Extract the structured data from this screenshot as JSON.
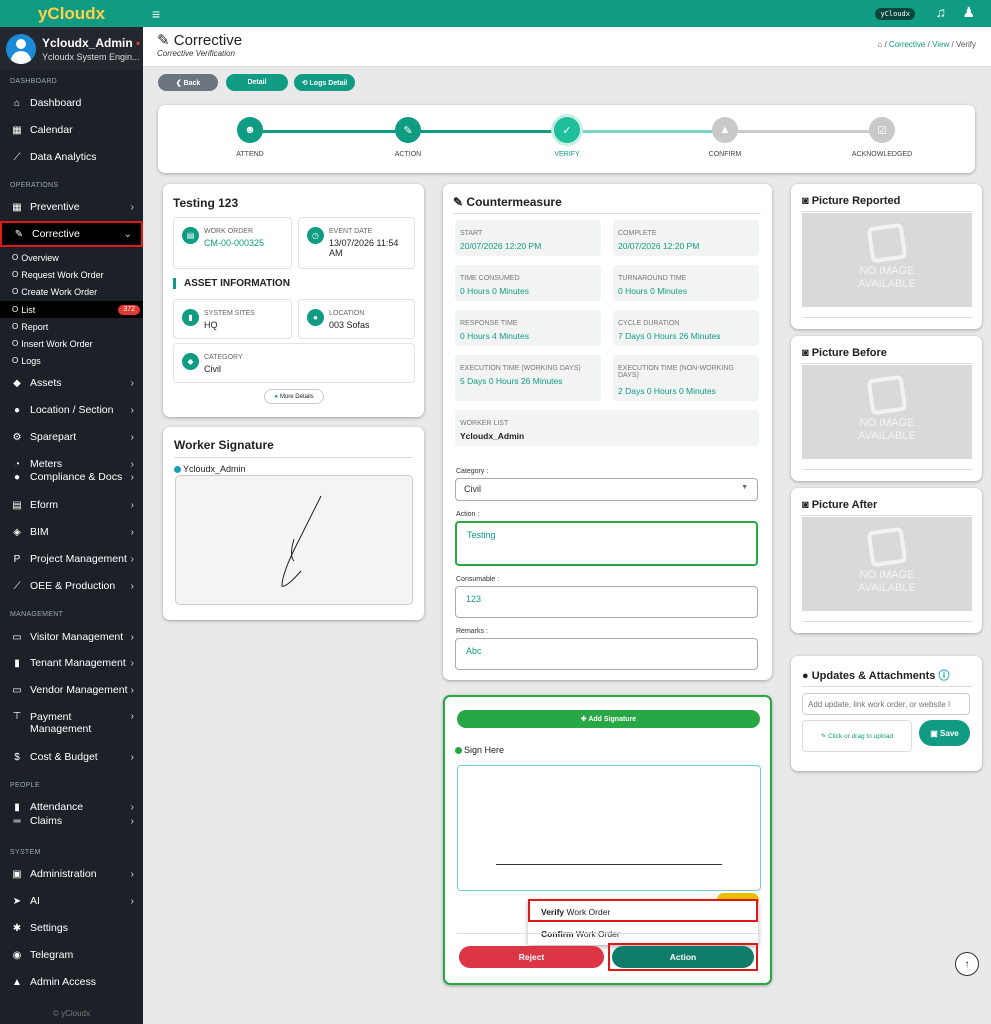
{
  "brand": "yCloudx",
  "profile": {
    "name": "Ycloudx_Admin",
    "status": "•",
    "role": "Ycloudx System Engin..."
  },
  "sidebar": {
    "dashboard_label": "DASHBOARD",
    "operations_label": "OPERATIONS",
    "management_label": "MANAGEMENT",
    "people_label": "PEOPLE",
    "system_label": "SYSTEM",
    "dashboard": [
      "Dashboard",
      "Calendar",
      "Data Analytics"
    ],
    "preventive": "Preventive",
    "corrective": "Corrective",
    "corrective_sub": [
      "Overview",
      "Request Work Order",
      "Create Work Order",
      "List",
      "Report",
      "Insert Work Order",
      "Logs"
    ],
    "list_badge": "372",
    "ops": [
      "Assets",
      "Location / Section",
      "Sparepart",
      "Meters",
      "Compliance & Docs",
      "Eform",
      "BIM",
      "Project Management",
      "OEE & Production"
    ],
    "mgmt": [
      "Visitor Management",
      "Tenant Management",
      "Vendor Management",
      "Payment Management",
      "Cost & Budget"
    ],
    "people": [
      "Attendance",
      "Claims"
    ],
    "system": [
      "Administration",
      "AI",
      "Settings",
      "Telegram",
      "Admin Access"
    ],
    "footer": "© yCloudx"
  },
  "topbar": {
    "pill": "yCloudx"
  },
  "header": {
    "title": "Corrective",
    "subtitle": "Corrective Verification",
    "crumbs": [
      "Corrective",
      "View",
      "Verify"
    ],
    "sep": "/"
  },
  "buttons": {
    "back": "❮ Back",
    "detail": "Detail",
    "logs": "⟲ Logs Detail"
  },
  "steps": [
    "ATTEND",
    "ACTION",
    "VERIFY",
    "CONFIRM",
    "ACKNOWLEDGED"
  ],
  "wo": {
    "title": "Testing 123",
    "wo_label": "WORK ORDER",
    "wo_value": "CM-00-000325",
    "event_label": "EVENT DATE",
    "event_value": "13/07/2026 11:54 AM",
    "asset_heading": "ASSET INFORMATION",
    "sites_label": "SYSTEM SITES",
    "sites_value": "HQ",
    "loc_label": "LOCATION",
    "loc_value": "003 Sofas",
    "cat_label": "CATEGORY",
    "cat_value": "Civil",
    "more": "More Details"
  },
  "signature": {
    "title": "Worker Signature",
    "name": "Ycloudx_Admin"
  },
  "cm": {
    "title": "Countermeasure",
    "metrics": [
      {
        "k": "START",
        "v": "20/07/2026 12:20 PM"
      },
      {
        "k": "COMPLETE",
        "v": "20/07/2026 12:20 PM"
      },
      {
        "k": "TIME CONSUMED",
        "v": "0 Hours 0 Minutes"
      },
      {
        "k": "TURNAROUND TIME",
        "v": "0 Hours 0 Minutes"
      },
      {
        "k": "RESPONSE TIME",
        "v": "0 Hours 4 Minutes"
      },
      {
        "k": "CYCLE DURATION",
        "v": "7 Days 0 Hours 26 Minutes"
      },
      {
        "k": "EXECUTION TIME (WORKING DAYS)",
        "v": "5 Days 0 Hours 26 Minutes"
      },
      {
        "k": "EXECUTION TIME (NON-WORKING DAYS)",
        "v": "2 Days 0 Hours 0 Minutes"
      }
    ],
    "worker_label": "WORKER LIST",
    "worker_value": "Ycloudx_Admin",
    "category_label": "Category :",
    "category_value": "Civil",
    "action_label": "Action :",
    "action_value": "Testing",
    "consumable_label": "Consumable :",
    "consumable_value": "123",
    "remarks_label": "Remarks :",
    "remarks_value": "Abc"
  },
  "signbox": {
    "add": "✚ Add Signature",
    "sign_here": "Sign Here",
    "reject": "Reject",
    "action": "Action",
    "menu": [
      {
        "b": "Verify",
        "r": " Work Order"
      },
      {
        "b": "Confirm",
        "r": " Work Order"
      }
    ]
  },
  "pictures": {
    "reported": "Picture Reported",
    "before": "Picture Before",
    "after": "Picture After",
    "no_image_1": "NO IMAGE",
    "no_image_2": "AVAILABLE"
  },
  "updates": {
    "title": "Updates & Attachments",
    "placeholder": "Add update, link work order, or website l",
    "upload": "✎ Click or drag to upload",
    "save": "Save"
  },
  "colors": {
    "teal": "#0f9c82",
    "red": "#dc3545",
    "grey": "#6c757d"
  }
}
